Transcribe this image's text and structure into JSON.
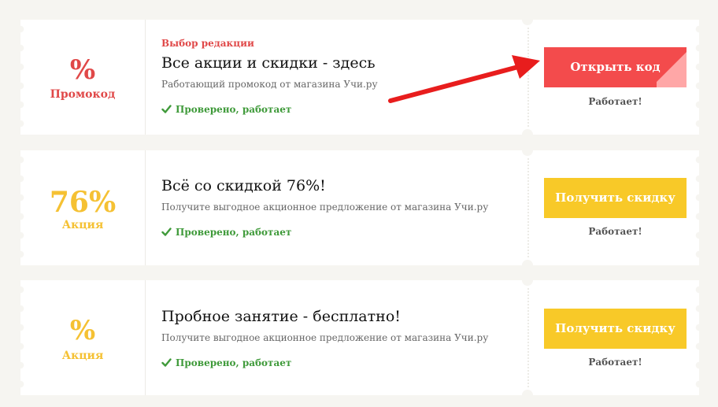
{
  "coupons": [
    {
      "big": "%",
      "type": "Промокод",
      "editor_label": "Выбор редакции",
      "title": "Все акции и скидки - здесь",
      "description": "Работающий промокод от магазина Учи.ру",
      "verified": "Проверено, работает",
      "button": "Открыть код",
      "status": "Работает!"
    },
    {
      "big": "76%",
      "type": "Акция",
      "title": "Всё со скидкой 76%!",
      "description": "Получите выгодное акционное предложение от магазина Учи.ру",
      "verified": "Проверено, работает",
      "button": "Получить скидку",
      "status": "Работает!"
    },
    {
      "big": "%",
      "type": "Акция",
      "title": "Пробное занятие - бесплатно!",
      "description": "Получите выгодное акционное предложение от магазина Учи.ру",
      "verified": "Проверено, работает",
      "button": "Получить скидку",
      "status": "Работает!"
    }
  ],
  "icons": {
    "verified": "check-icon",
    "annotation": "red-arrow"
  },
  "colors": {
    "promo_red": "#e04848",
    "button_red": "#f34b4c",
    "deal_gold": "#f5c133",
    "button_gold": "#f8c928",
    "verified_green": "#3f9a3a",
    "arrow_red": "#e81d1d",
    "page_background": "#f6f5f1"
  }
}
